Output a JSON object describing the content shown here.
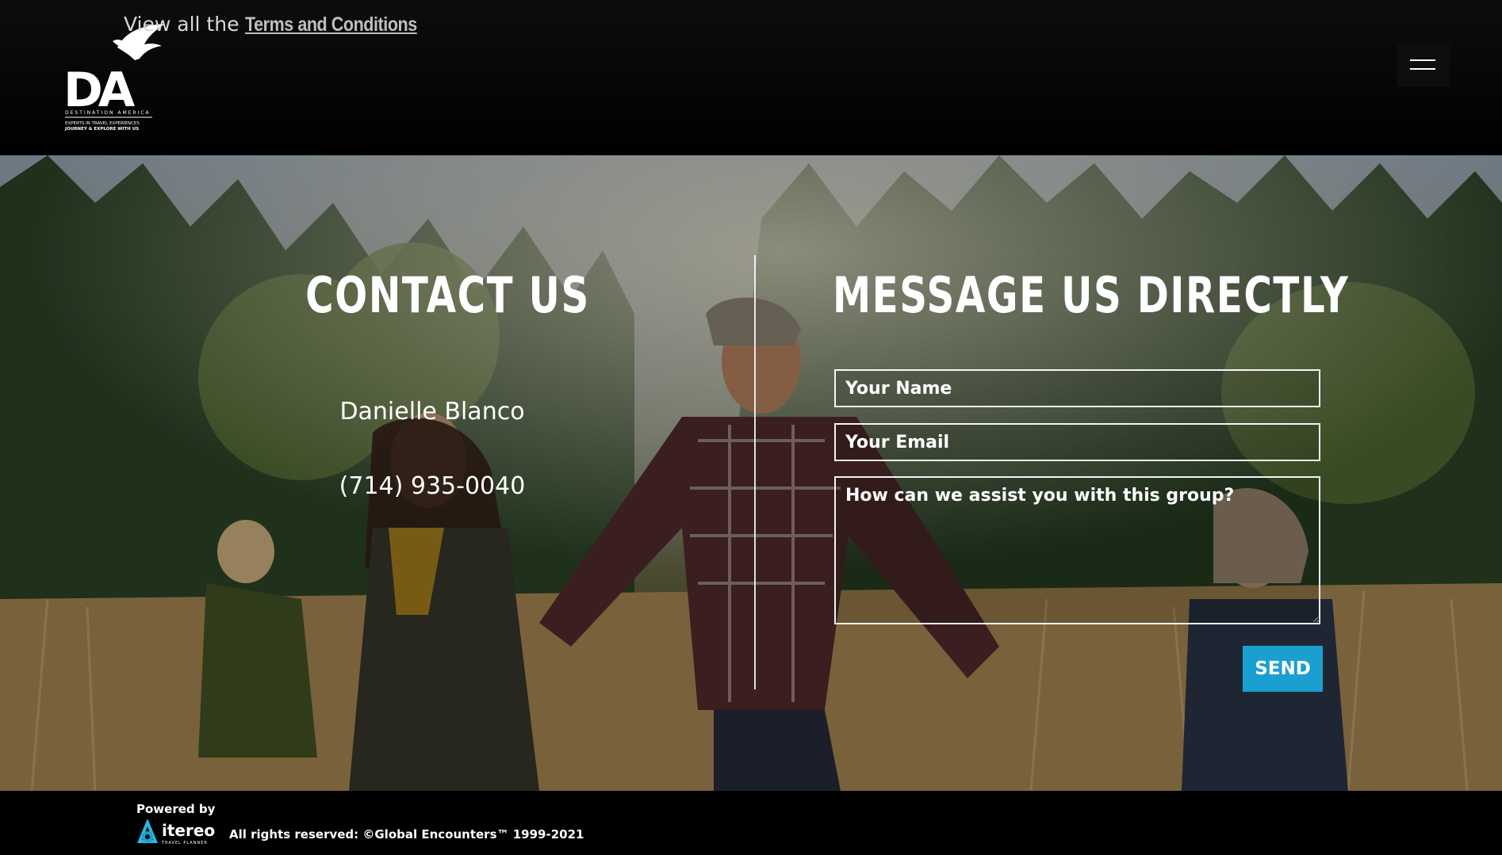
{
  "header": {
    "terms_prefix": "View all the",
    "terms_link": "Terms and Conditions",
    "logo": {
      "mark": "DA",
      "line1": "DESTINATION AMERICA",
      "line2": "EXPERTS IN TRAVEL EXPERIENCES",
      "line3": "JOURNEY & EXPLORE WITH US",
      "icon": "eagle-icon"
    },
    "menu_icon": "hamburger-menu-icon"
  },
  "contact": {
    "title": "CONTACT US",
    "name": "Danielle Blanco",
    "phone": "(714) 935-0040"
  },
  "message": {
    "title": "MESSAGE US DIRECTLY",
    "name_placeholder": "Your Name",
    "email_placeholder": "Your Email",
    "message_placeholder": "How can we assist you with this group?",
    "send_label": "SEND"
  },
  "footer": {
    "powered_by": "Powered by",
    "brand": "itereo",
    "brand_sub": "TRAVEL PLANNER",
    "rights": "All rights reserved: ©Global Encounters™ 1999-2021"
  },
  "colors": {
    "accent": "#1b9fd0",
    "header_bg": "#000000"
  }
}
